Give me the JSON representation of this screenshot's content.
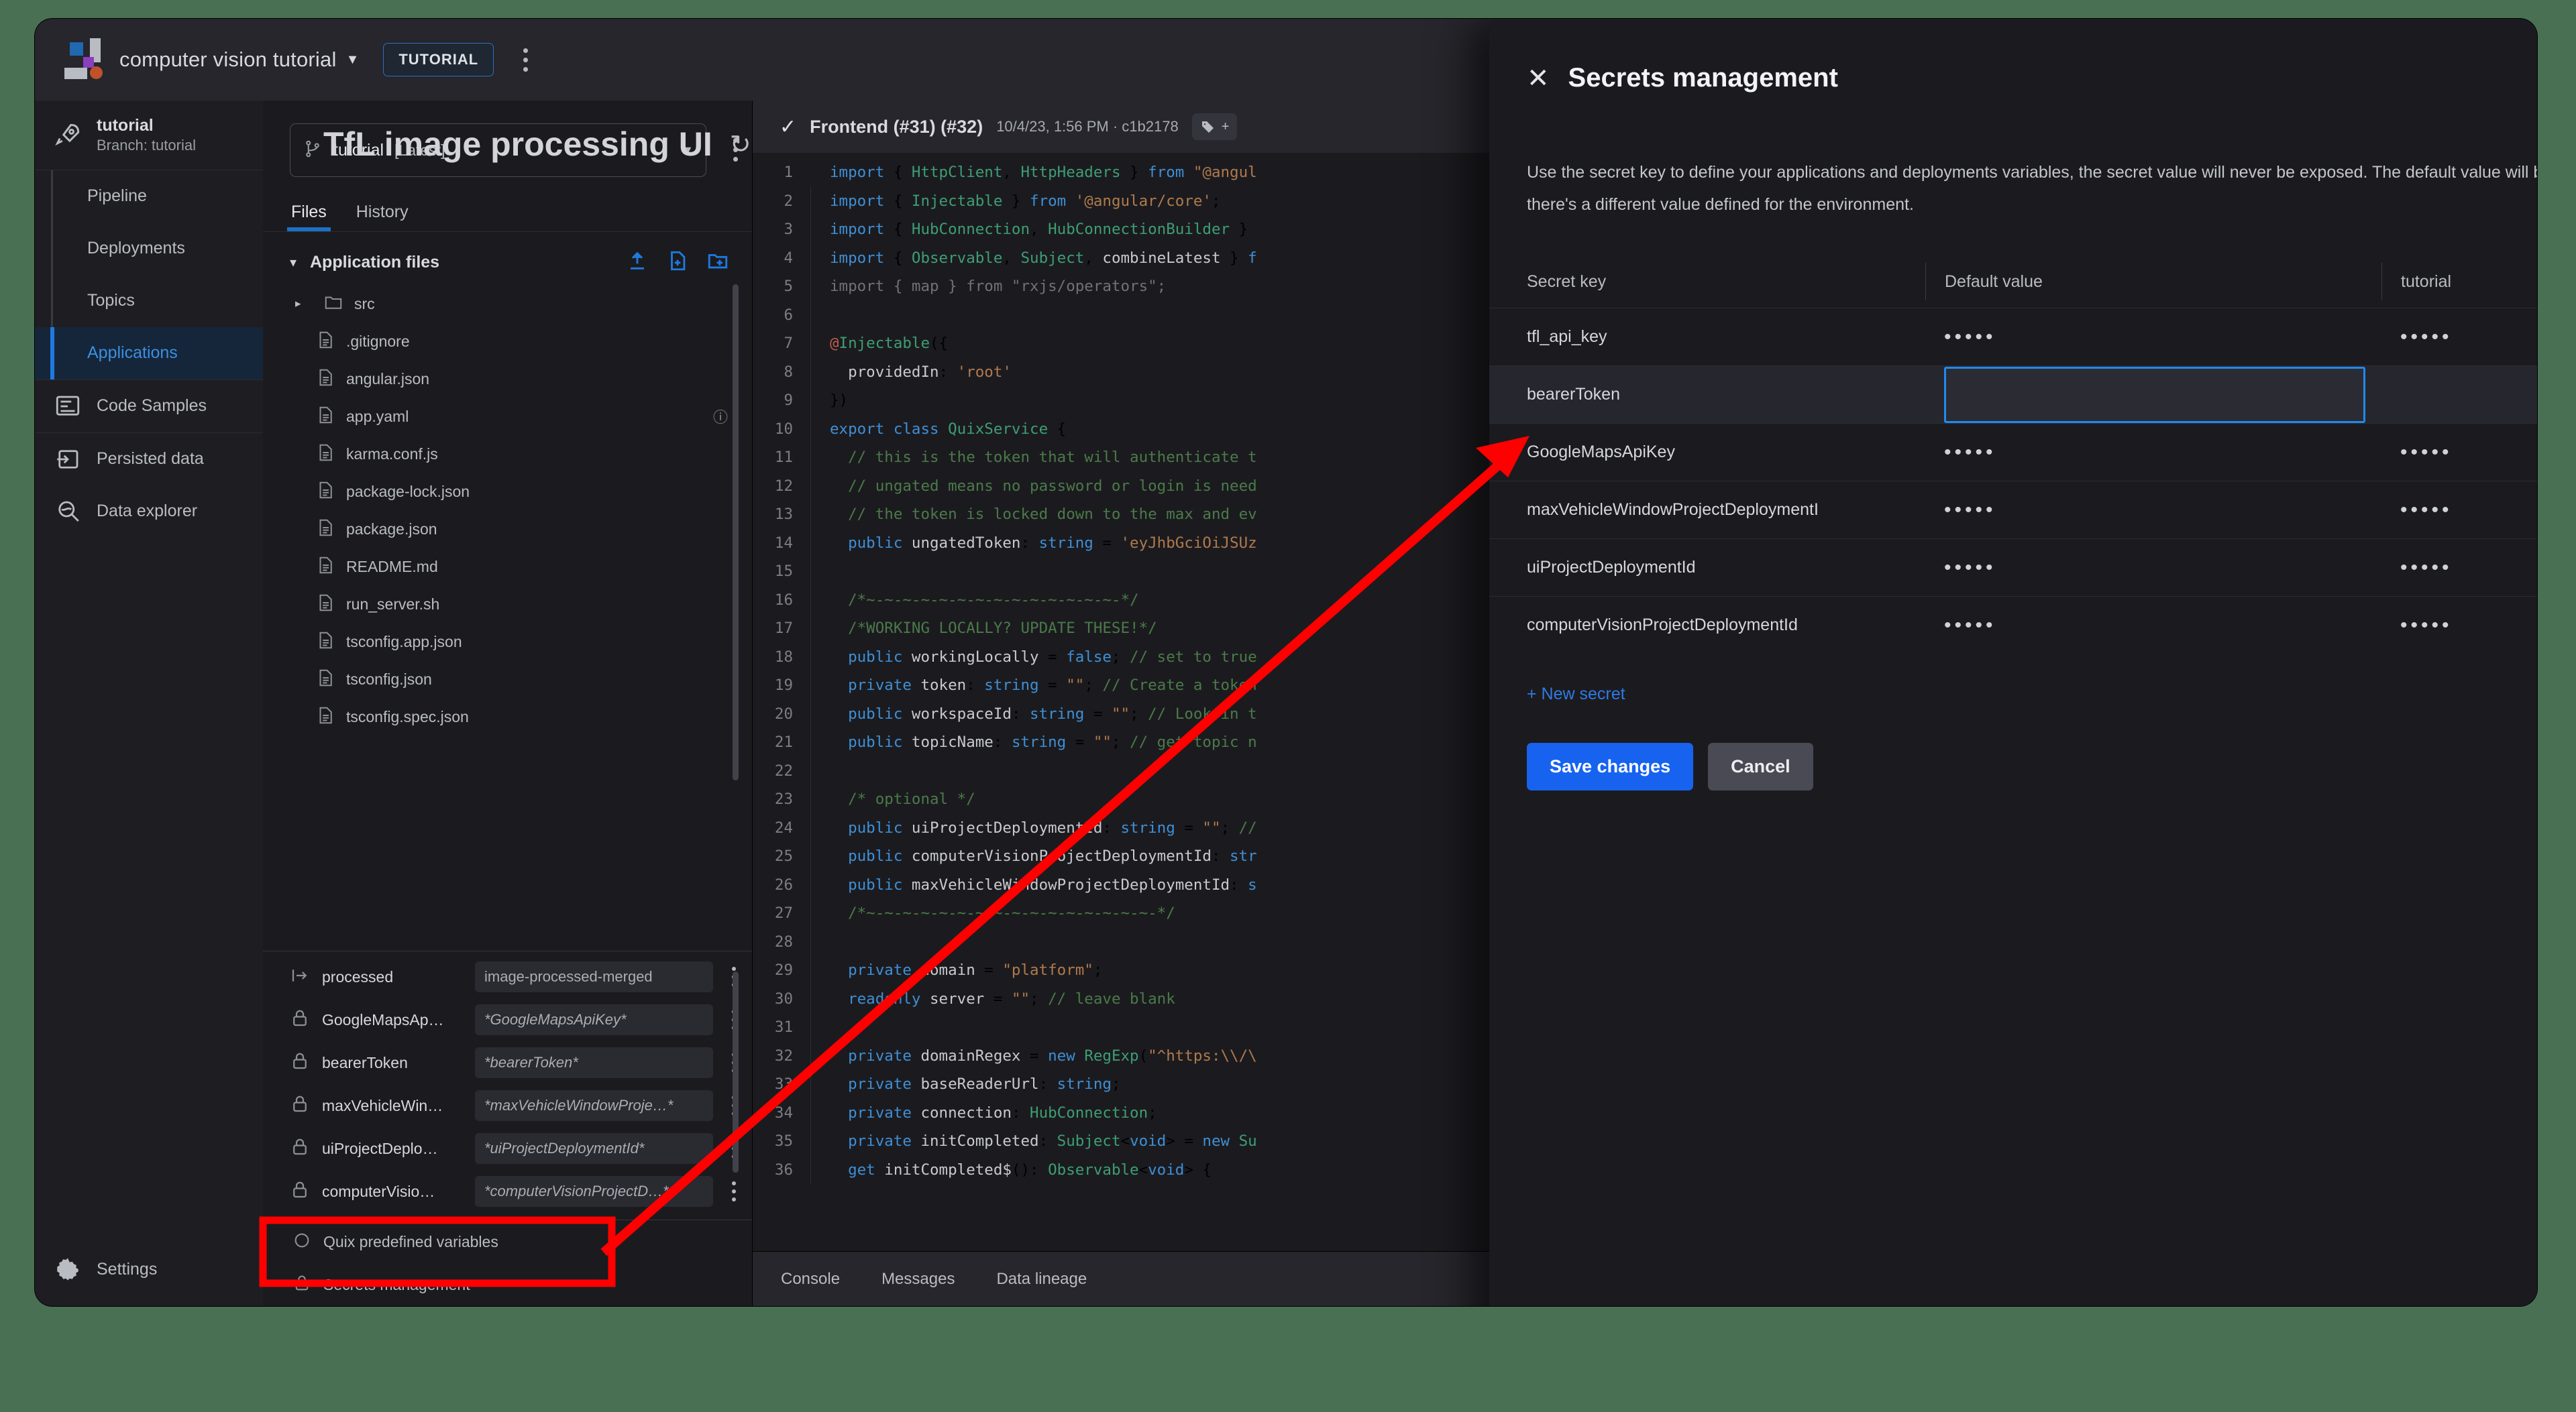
{
  "topbar": {
    "project_name": "computer vision tutorial",
    "env_chip": "TUTORIAL",
    "logo_name": "quix-logo",
    "menu_name": "more-options"
  },
  "sidebar": {
    "project": {
      "title": "tutorial",
      "branch": "Branch: tutorial"
    },
    "items": [
      {
        "label": "Pipeline",
        "icon": ""
      },
      {
        "label": "Deployments",
        "icon": ""
      },
      {
        "label": "Topics",
        "icon": ""
      },
      {
        "label": "Applications",
        "icon": "",
        "active": true
      }
    ],
    "extra_items": [
      {
        "label": "Code Samples",
        "icon": "code-samples-icon"
      },
      {
        "label": "Persisted data",
        "icon": "persisted-data-icon"
      },
      {
        "label": "Data explorer",
        "icon": "data-explorer-icon"
      }
    ],
    "settings_label": "Settings"
  },
  "header": {
    "title": "TfL image processing UI",
    "refresh_glyph": "↻"
  },
  "files": {
    "branch_value": "tutorial",
    "branch_tag": "[Latest]",
    "tabs": [
      {
        "label": "Files",
        "selected": true
      },
      {
        "label": "History",
        "selected": false
      }
    ],
    "tree_header": "Application files",
    "tree_actions": [
      "upload-icon",
      "new-file-icon",
      "new-folder-icon"
    ],
    "rows": [
      {
        "name": "src",
        "type": "folder"
      },
      {
        "name": ".gitignore",
        "type": "file"
      },
      {
        "name": "angular.json",
        "type": "file"
      },
      {
        "name": "app.yaml",
        "type": "file",
        "info": true
      },
      {
        "name": "karma.conf.js",
        "type": "file"
      },
      {
        "name": "package-lock.json",
        "type": "file"
      },
      {
        "name": "package.json",
        "type": "file"
      },
      {
        "name": "README.md",
        "type": "file"
      },
      {
        "name": "run_server.sh",
        "type": "file"
      },
      {
        "name": "tsconfig.app.json",
        "type": "file"
      },
      {
        "name": "tsconfig.json",
        "type": "file"
      },
      {
        "name": "tsconfig.spec.json",
        "type": "file"
      }
    ],
    "variables": [
      {
        "icon": "output-icon",
        "name": "processed",
        "value": "image-processed-merged",
        "italic": false
      },
      {
        "icon": "lock-icon",
        "name": "GoogleMapsAp…",
        "value": "*GoogleMapsApiKey*",
        "italic": true
      },
      {
        "icon": "lock-icon",
        "name": "bearerToken",
        "value": "*bearerToken*",
        "italic": true
      },
      {
        "icon": "lock-icon",
        "name": "maxVehicleWin…",
        "value": "*maxVehicleWindowProje…*",
        "italic": true
      },
      {
        "icon": "lock-icon",
        "name": "uiProjectDeplo…",
        "value": "*uiProjectDeploymentId*",
        "italic": true
      },
      {
        "icon": "lock-icon",
        "name": "computerVisio…",
        "value": "*computerVisionProjectD…*",
        "italic": true
      }
    ],
    "footer_links": [
      {
        "label": "Quix predefined variables",
        "icon": "quix-variables-icon"
      },
      {
        "label": "Secrets management",
        "icon": "lock-icon"
      }
    ]
  },
  "editor": {
    "status_glyph": "✓",
    "deployment": "Frontend (#31) (#32)",
    "meta": "10/4/23, 1:56 PM · c1b2178",
    "tag_button": "+",
    "footer_tabs": [
      "Console",
      "Messages",
      "Data lineage"
    ],
    "lines": [
      {
        "n": "1",
        "html": "<span class='kw'>import</span> { <span class='ty'>HttpClient</span>, <span class='ty'>HttpHeaders</span> } <span class='kw'>from</span> <span class='st'>\"@angul</span>"
      },
      {
        "n": "2",
        "html": "<span class='kw'>import</span> { <span class='ty'>Injectable</span> } <span class='kw'>from</span> <span class='st'>'@angular/core'</span>;"
      },
      {
        "n": "3",
        "html": "<span class='kw'>import</span> { <span class='ty'>HubConnection</span>, <span class='ty'>HubConnectionBuilder</span> }"
      },
      {
        "n": "4",
        "html": "<span class='kw'>import</span> { <span class='ty'>Observable</span>, <span class='ty'>Subject</span>, <span class='pl'>combineLatest</span> } <span class='kw'>f</span>"
      },
      {
        "n": "5",
        "html": "<span class='dim'>import { map } from \"rxjs/operators\";</span>"
      },
      {
        "n": "6",
        "html": ""
      },
      {
        "n": "7",
        "html": "<span class='dec'>@</span><span class='ty'>Injectable</span>({"
      },
      {
        "n": "8",
        "html": "  <span class='pl'>providedIn</span>: <span class='st'>'root'</span>"
      },
      {
        "n": "9",
        "html": "})"
      },
      {
        "n": "10",
        "html": "<span class='kw'>export class</span> <span class='ty'>QuixService</span> {"
      },
      {
        "n": "11",
        "html": "  <span class='cm'>// this is the token that will authenticate t</span>"
      },
      {
        "n": "12",
        "html": "  <span class='cm'>// ungated means no password or login is need</span>"
      },
      {
        "n": "13",
        "html": "  <span class='cm'>// the token is locked down to the max and ev</span>"
      },
      {
        "n": "14",
        "html": "  <span class='kw'>public</span> <span class='fn'>ungatedToken</span>: <span class='kw'>string</span> = <span class='st'>'eyJhbGciOiJSUz</span>"
      },
      {
        "n": "15",
        "html": ""
      },
      {
        "n": "16",
        "html": "  <span class='cm'>/*~-~-~-~-~-~-~-~-~-~-~-~-~-~-*/</span>"
      },
      {
        "n": "17",
        "html": "  <span class='cm'>/*WORKING LOCALLY? UPDATE THESE!*/</span>"
      },
      {
        "n": "18",
        "html": "  <span class='kw'>public</span> <span class='fn'>workingLocally</span> = <span class='kw'>false</span>; <span class='cm'>// set to true</span>"
      },
      {
        "n": "19",
        "html": "  <span class='kw'>private</span> <span class='fn'>token</span>: <span class='kw'>string</span> = <span class='st'>\"\"</span>; <span class='cm'>// Create a token</span>"
      },
      {
        "n": "20",
        "html": "  <span class='kw'>public</span> <span class='fn'>workspaceId</span>: <span class='kw'>string</span> = <span class='st'>\"\"</span>; <span class='cm'>// Look in t</span>"
      },
      {
        "n": "21",
        "html": "  <span class='kw'>public</span> <span class='fn'>topicName</span>: <span class='kw'>string</span> = <span class='st'>\"\"</span>; <span class='cm'>// get topic n</span>"
      },
      {
        "n": "22",
        "html": ""
      },
      {
        "n": "23",
        "html": "  <span class='cm'>/* optional */</span>"
      },
      {
        "n": "24",
        "html": "  <span class='kw'>public</span> <span class='fn'>uiProjectDeploymentId</span>: <span class='kw'>string</span> = <span class='st'>\"\"</span>; <span class='cm'>//</span>"
      },
      {
        "n": "25",
        "html": "  <span class='kw'>public</span> <span class='fn'>computerVisionProjectDeploymentId</span>: <span class='kw'>str</span>"
      },
      {
        "n": "26",
        "html": "  <span class='kw'>public</span> <span class='fn'>maxVehicleWindowProjectDeploymentId</span>: <span class='kw'>s</span>"
      },
      {
        "n": "27",
        "html": "  <span class='cm'>/*~-~-~-~-~-~-~-~-~-~-~-~-~-~-~-~-*/</span>"
      },
      {
        "n": "28",
        "html": ""
      },
      {
        "n": "29",
        "html": "  <span class='kw'>private</span> <span class='fn'>domain</span> = <span class='st'>\"platform\"</span>;"
      },
      {
        "n": "30",
        "html": "  <span class='kw'>readonly</span> <span class='fn'>server</span> = <span class='st'>\"\"</span>; <span class='cm'>// leave blank</span>"
      },
      {
        "n": "31",
        "html": ""
      },
      {
        "n": "32",
        "html": "  <span class='kw'>private</span> <span class='fn'>domainRegex</span> = <span class='kw'>new</span> <span class='ty'>RegExp</span>(<span class='st'>\"^https:\\\\/\\</span>"
      },
      {
        "n": "33",
        "html": "  <span class='kw'>private</span> <span class='fn'>baseReaderUrl</span>: <span class='kw'>string</span>;"
      },
      {
        "n": "34",
        "html": "  <span class='kw'>private</span> <span class='fn'>connection</span>: <span class='ty'>HubConnection</span>;"
      },
      {
        "n": "35",
        "html": "  <span class='kw'>private</span> <span class='fn'>initCompleted</span>: <span class='ty'>Subject</span>&lt;<span class='kw'>void</span>&gt; = <span class='kw'>new</span> <span class='ty'>Su</span>"
      },
      {
        "n": "36",
        "html": "  <span class='kw'>get</span> <span class='fn'>initCompleted$</span>(): <span class='ty'>Observable</span>&lt;<span class='kw'>void</span>&gt; {"
      }
    ]
  },
  "secrets": {
    "close_icon": "close-icon",
    "title": "Secrets management",
    "description": "Use the secret key to define your applications and deployments variables, the secret value will never be exposed. The default value will be applied unless there's a different value defined for the environment.",
    "columns": [
      "Secret key",
      "Default value",
      "tutorial"
    ],
    "rows": [
      {
        "key": "tfl_api_key",
        "default": "•••••",
        "env": "•••••",
        "editing": false
      },
      {
        "key": "bearerToken",
        "default": "",
        "env": "",
        "editing": true
      },
      {
        "key": "GoogleMapsApiKey",
        "default": "•••••",
        "env": "•••••",
        "editing": false
      },
      {
        "key": "maxVehicleWindowProjectDeploymentI",
        "default": "•••••",
        "env": "•••••",
        "editing": false
      },
      {
        "key": "uiProjectDeploymentId",
        "default": "•••••",
        "env": "•••••",
        "editing": false
      },
      {
        "key": "computerVisionProjectDeploymentId",
        "default": "•••••",
        "env": "•••••",
        "editing": false
      }
    ],
    "new_secret_label": "+ New secret",
    "save_label": "Save changes",
    "cancel_label": "Cancel"
  },
  "annotation": {
    "color": "#ff0000"
  },
  "colors": {
    "accent_blue": "#1f7ae0",
    "primary_button": "#1763f0",
    "page_background": "#4a7054",
    "panel_background": "#1b1b1f",
    "annotation_red": "#ff0000"
  }
}
